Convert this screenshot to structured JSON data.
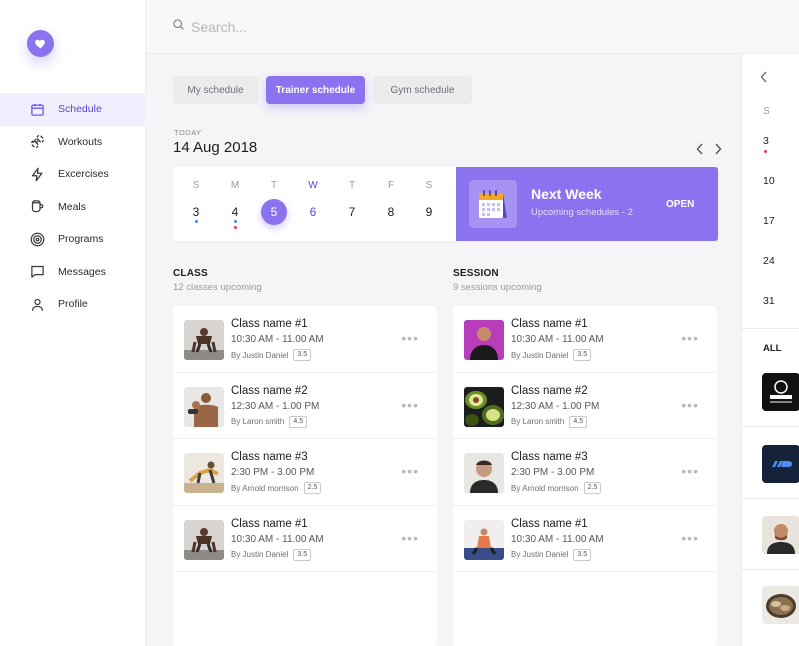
{
  "search": {
    "placeholder": "Search..."
  },
  "sidebar": {
    "items": [
      {
        "label": "Schedule",
        "icon": "calendar-icon",
        "active": true
      },
      {
        "label": "Workouts",
        "icon": "dumbbell-icon"
      },
      {
        "label": "Excercises",
        "icon": "lightning-icon"
      },
      {
        "label": "Meals",
        "icon": "cup-icon"
      },
      {
        "label": "Programs",
        "icon": "target-icon"
      },
      {
        "label": "Messages",
        "icon": "chat-icon"
      },
      {
        "label": "Profile",
        "icon": "user-icon"
      }
    ]
  },
  "tabs": [
    "My schedule",
    "Trainer schedule",
    "Gym schedule"
  ],
  "today": {
    "label": "TODAY",
    "date": "14 Aug 2018"
  },
  "week": {
    "days": [
      {
        "letter": "S",
        "num": "3"
      },
      {
        "letter": "M",
        "num": "4"
      },
      {
        "letter": "T",
        "num": "5"
      },
      {
        "letter": "W",
        "num": "6"
      },
      {
        "letter": "T",
        "num": "7"
      },
      {
        "letter": "F",
        "num": "8"
      },
      {
        "letter": "S",
        "num": "9"
      }
    ]
  },
  "next_week": {
    "title": "Next Week",
    "subtitle": "Upcoming schedules - 2",
    "action": "OPEN"
  },
  "class_section": {
    "title": "CLASS",
    "subtitle": "12 classes upcoming",
    "items": [
      {
        "name": "Class name #1",
        "time": "10:30 AM - 11.00 AM",
        "by": "By Justin Daniel",
        "rating": "3.5"
      },
      {
        "name": "Class name #2",
        "time": "12:30 AM - 1.00 PM",
        "by": "By Laron smith",
        "rating": "4.5"
      },
      {
        "name": "Class name #3",
        "time": "2:30 PM - 3.00 PM",
        "by": "By Arnold morrison",
        "rating": "2.5"
      },
      {
        "name": "Class name #1",
        "time": "10:30 AM - 11.00 AM",
        "by": "By Justin Daniel",
        "rating": "3.5"
      }
    ]
  },
  "session_section": {
    "title": "SESSION",
    "subtitle": "9 sessions upcoming",
    "items": [
      {
        "name": "Class name #1",
        "time": "10:30 AM - 11.00 AM",
        "by": "By Justin Daniel",
        "rating": "3.5"
      },
      {
        "name": "Class name #2",
        "time": "12:30 AM - 1.00 PM",
        "by": "By Laron smith",
        "rating": "4.5"
      },
      {
        "name": "Class name #3",
        "time": "2:30 PM - 3.00 PM",
        "by": "By Arnold morrison",
        "rating": "2.5"
      },
      {
        "name": "Class name #1",
        "time": "10:30 AM - 11.00 AM",
        "by": "By Justin Daniel",
        "rating": "3.5"
      }
    ]
  },
  "right_panel": {
    "day_letter": "S",
    "dates": [
      "3",
      "10",
      "17",
      "24",
      "31"
    ],
    "all_label": "ALL"
  },
  "colors": {
    "accent": "#8b73ef",
    "accent_dark": "#5b44d6",
    "dot_blue": "#3a8bf0",
    "dot_red": "#e8365e"
  }
}
